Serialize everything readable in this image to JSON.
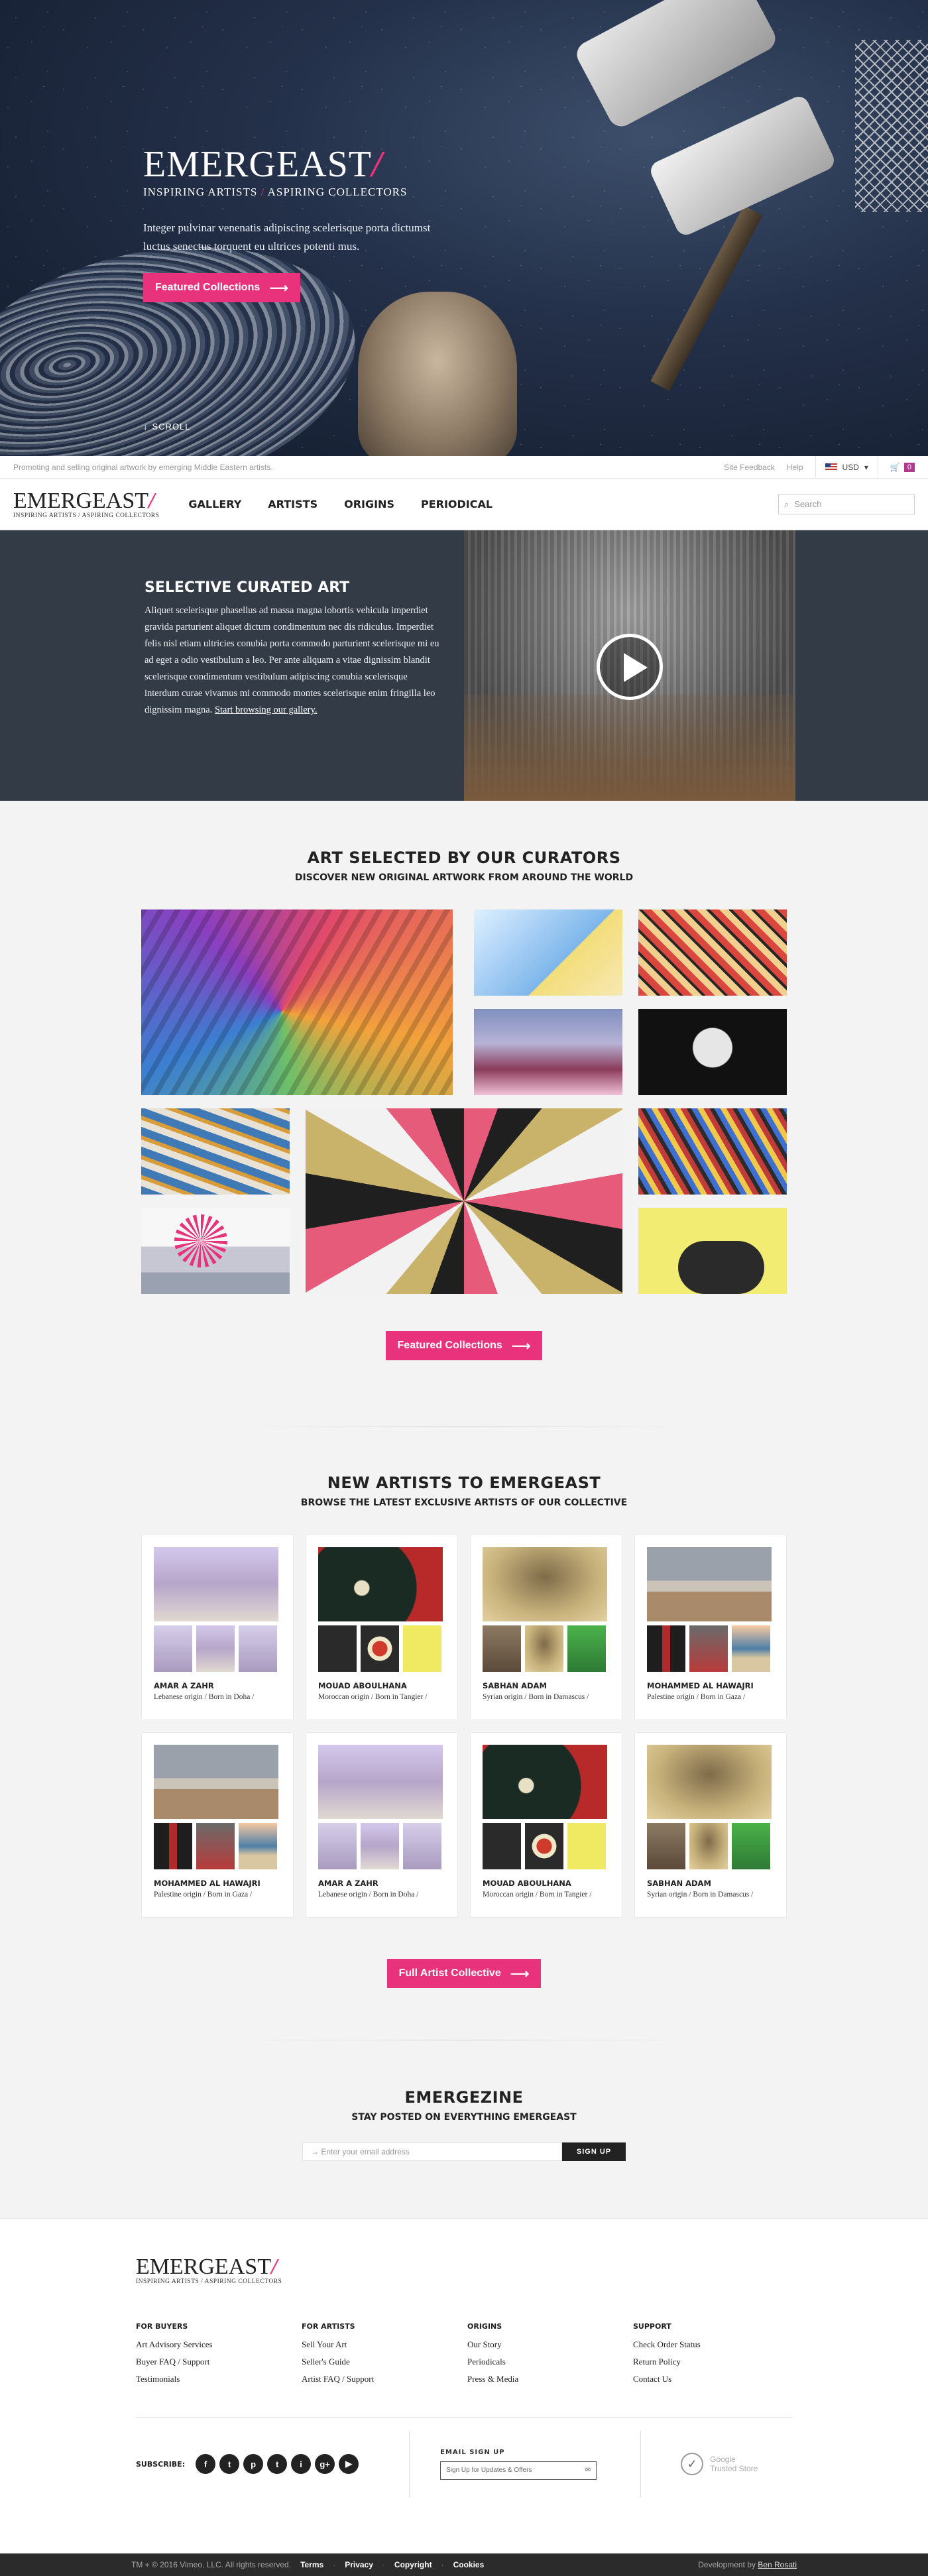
{
  "hero": {
    "logo": "EMERGEAST",
    "tagline_a": "INSPIRING ARTISTS",
    "tagline_slash": "/",
    "tagline_b": "ASPIRING COLLECTORS",
    "text": "Integer pulvinar venenatis adipiscing scelerisque porta dictumst luctus senectus torquent eu ultrices potenti mus.",
    "cta": "Featured Collections",
    "scroll": "SCROLL"
  },
  "topbar": {
    "promo": "Promoting and selling original artwork by emerging Middle Eastern artists.",
    "feedback": "Site Feedback",
    "help": "Help",
    "currency": "USD",
    "cart_count": "0"
  },
  "nav": {
    "logo": "EMERGEAST",
    "logo_tag": "INSPIRING ARTISTS / ASPIRING COLLECTORS",
    "links": [
      "GALLERY",
      "ARTISTS",
      "ORIGINS",
      "PERIODICAL"
    ],
    "search_placeholder": "Search"
  },
  "curated": {
    "title": "SELECTIVE CURATED ART",
    "body": "Aliquet scelerisque phasellus ad massa magna lobortis vehicula imperdiet gravida parturient aliquet dictum condimentum nec dis ridiculus. Imperdiet felis nisl etiam ultricies conubia porta commodo parturient scelerisque mi eu ad eget a odio vestibulum a leo. Per ante aliquam a vitae dignissim blandit scelerisque condimentum vestibulum adipiscing conubia scelerisque interdum curae vivamus mi commodo montes scelerisque enim fringilla leo dignissim magna.",
    "link": "Start browsing our gallery."
  },
  "curators": {
    "title": "ART SELECTED BY OUR CURATORS",
    "subtitle": "DISCOVER NEW ORIGINAL ARTWORK FROM AROUND THE WORLD",
    "cta": "Featured Collections"
  },
  "new_artists": {
    "title": "NEW ARTISTS TO EMERGEAST",
    "subtitle": "BROWSE THE LATEST EXCLUSIVE ARTISTS OF OUR COLLECTIVE",
    "cards": [
      {
        "name": "AMAR A ZAHR",
        "origin": "Lebanese origin / Born in Doha /"
      },
      {
        "name": "MOUAD ABOULHANA",
        "origin": "Moroccan origin / Born in Tangier /"
      },
      {
        "name": "SABHAN ADAM",
        "origin": "Syrian origin / Born in Damascus /"
      },
      {
        "name": "MOHAMMED AL HAWAJRI",
        "origin": "Palestine origin / Born in Gaza /"
      },
      {
        "name": "MOHAMMED AL HAWAJRI",
        "origin": "Palestine origin / Born in Gaza /"
      },
      {
        "name": "AMAR A ZAHR",
        "origin": "Lebanese origin / Born in Doha /"
      },
      {
        "name": "MOUAD ABOULHANA",
        "origin": "Moroccan origin / Born in Tangier /"
      },
      {
        "name": "SABHAN ADAM",
        "origin": "Syrian origin / Born in Damascus /"
      }
    ],
    "cta": "Full Artist Collective"
  },
  "emergezine": {
    "title": "EMERGEZINE",
    "subtitle": "STAY POSTED ON EVERYTHING EMERGEAST",
    "placeholder": "Enter your email address",
    "button": "SIGN UP"
  },
  "footer": {
    "logo": "EMERGEAST",
    "logo_tag": "INSPIRING ARTISTS / ASPIRING COLLECTORS",
    "cols": [
      {
        "title": "FOR BUYERS",
        "links": [
          "Art Advisory Services",
          "Buyer FAQ / Support",
          "Testimonials"
        ]
      },
      {
        "title": "FOR ARTISTS",
        "links": [
          "Sell Your Art",
          "Seller's Guide",
          "Artist FAQ / Support"
        ]
      },
      {
        "title": "ORIGINS",
        "links": [
          "Our Story",
          "Periodicals",
          "Press & Media"
        ]
      },
      {
        "title": "SUPPORT",
        "links": [
          "Check Order Status",
          "Return Policy",
          "Contact Us"
        ]
      }
    ],
    "subscribe_label": "SUBSCRIBE:",
    "social": [
      "f",
      "t",
      "p",
      "t",
      "i",
      "g+",
      "▶"
    ],
    "email_signup_label": "EMAIL SIGN UP",
    "email_signup_placeholder": "Sign Up for Updates & Offers",
    "trusted_a": "Google",
    "trusted_b": "Trusted Store",
    "copyright": "TM + © 2016 Vimeo, LLC. All rights reserved.",
    "links": [
      "Terms",
      "Privacy",
      "Copyright",
      "Cookies"
    ],
    "dev_prefix": "Development by",
    "dev_name": "Ben Rosati"
  }
}
